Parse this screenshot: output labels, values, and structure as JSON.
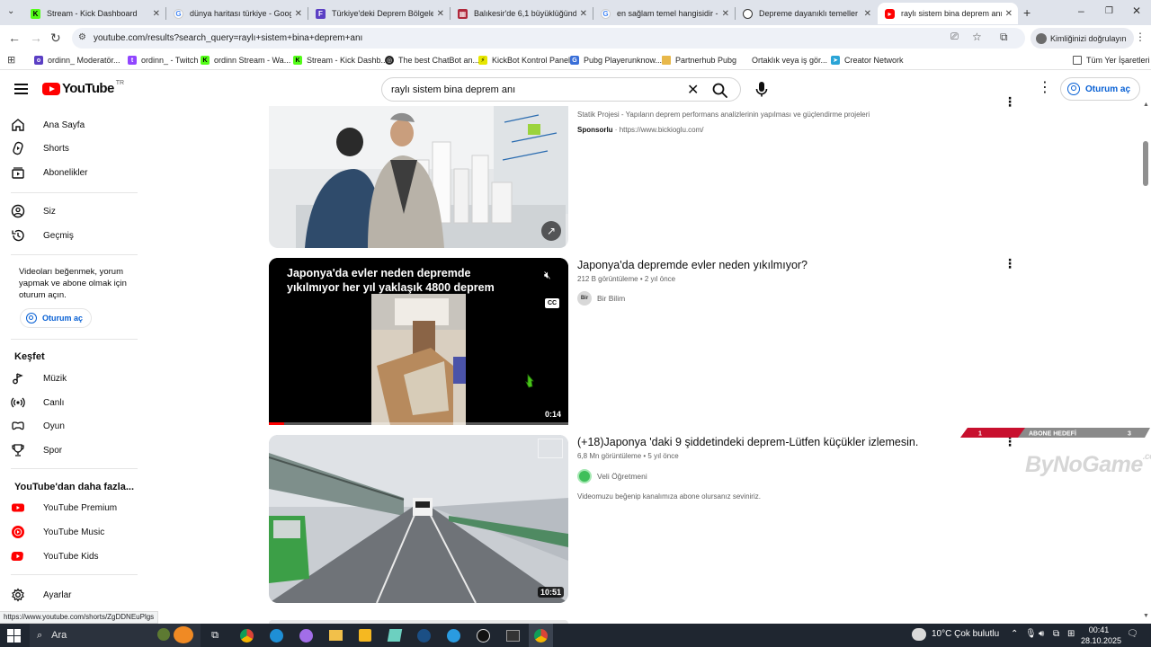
{
  "browser": {
    "tabs": [
      {
        "title": "Stream - Kick Dashboard",
        "icon": "kick-icon",
        "color": "#53fc18"
      },
      {
        "title": "dünya haritası türkiye - Google",
        "icon": "google-icon",
        "color": "#4285f4"
      },
      {
        "title": "Türkiye'deki Deprem Bölgeleri",
        "icon": "document-icon",
        "color": "#5b3fc4"
      },
      {
        "title": "Balıkesir'de 6,1 büyüklüğünde",
        "icon": "news-icon",
        "color": "#b0283b"
      },
      {
        "title": "en sağlam temel hangisidir - G",
        "icon": "google-icon",
        "color": "#4285f4"
      },
      {
        "title": "Depreme dayanıklı temeller",
        "icon": "openai-icon",
        "color": "#333333"
      },
      {
        "title": "raylı sistem bina deprem anı - Y",
        "icon": "youtube-icon",
        "color": "#ff0000"
      }
    ],
    "url": "youtube.com/results?search_query=raylı+sistem+bina+deprem+anı",
    "verify_label": "Kimliğinizi doğrulayın",
    "bookmarks": [
      {
        "label": "ordinn_ Moderatör...",
        "icon": "kick-icon",
        "color": "#5b3fc4"
      },
      {
        "label": "ordinn_ - Twitch",
        "icon": "twitch-icon",
        "color": "#9146ff"
      },
      {
        "label": "ordinn Stream - Wa...",
        "icon": "kick-icon",
        "color": "#53fc18"
      },
      {
        "label": "Stream - Kick Dashb...",
        "icon": "kick-icon",
        "color": "#53fc18"
      },
      {
        "label": "The best ChatBot an...",
        "icon": "chatbot-icon",
        "color": "#222222"
      },
      {
        "label": "KickBot Kontrol Paneli",
        "icon": "kickbot-icon",
        "color": "#e6e600"
      },
      {
        "label": "Pubg Playerunknow...",
        "icon": "pubg-icon",
        "color": "#3a6fd8"
      },
      {
        "label": "Partnerhub Pubg",
        "icon": "folder-icon",
        "color": "#e8b84a"
      },
      {
        "label": "Ortaklık veya iş gör...",
        "icon": "link-icon",
        "color": "#ffffff"
      },
      {
        "label": "Creator Network",
        "icon": "creator-network-icon",
        "color": "#2aa4d6"
      }
    ],
    "all_bookmarks_label": "Tüm Yer İşaretleri",
    "status_url": "https://www.youtube.com/shorts/ZgDDNEuPlgs"
  },
  "youtube": {
    "logo_text": "YouTube",
    "logo_region": "TR",
    "search_value": "raylı sistem bina deprem anı",
    "signin_label": "Oturum aç",
    "sidebar": {
      "main": [
        {
          "label": "Ana Sayfa",
          "icon": "home-icon"
        },
        {
          "label": "Shorts",
          "icon": "shorts-icon"
        },
        {
          "label": "Abonelikler",
          "icon": "subscriptions-icon"
        }
      ],
      "you": [
        {
          "label": "Siz",
          "icon": "you-icon"
        },
        {
          "label": "Geçmiş",
          "icon": "history-icon"
        }
      ],
      "note": "Videoları beğenmek, yorum yapmak ve abone olmak için oturum açın.",
      "signin_label": "Oturum aç",
      "explore_title": "Keşfet",
      "explore": [
        {
          "label": "Müzik",
          "icon": "music-icon"
        },
        {
          "label": "Canlı",
          "icon": "live-icon"
        },
        {
          "label": "Oyun",
          "icon": "gaming-icon"
        },
        {
          "label": "Spor",
          "icon": "trophy-icon"
        }
      ],
      "more_title": "YouTube'dan daha fazla...",
      "more": [
        {
          "label": "YouTube Premium",
          "icon": "youtube-premium-icon"
        },
        {
          "label": "YouTube Music",
          "icon": "youtube-music-icon"
        },
        {
          "label": "YouTube Kids",
          "icon": "youtube-kids-icon"
        }
      ],
      "settings_label": "Ayarlar"
    },
    "results": [
      {
        "type": "ad",
        "description": "Statik Projesi - Yapıların deprem performans analizlerinin yapılması ve güçlendirme projeleri",
        "sponsor_label": "Sponsorlu",
        "sponsor_url": "https://www.bickioglu.com/"
      },
      {
        "title": "Japonya'da depremde evler neden yıkılmıyor?",
        "views": "212 B görüntüleme",
        "age": "2 yıl önce",
        "channel": "Bir Bilim",
        "channel_avatar_text": "Bir",
        "duration": "0:14",
        "thumb_caption": "Japonya'da evler neden depremde yıkılmıyor her yıl yaklaşık 4800 deprem",
        "cc_label": "CC",
        "progress": 0.05
      },
      {
        "title": "(+18)Japonya 'daki 9 şiddetindeki deprem-Lütfen küçükler izlemesin.",
        "views": "6,8 Mn görüntüleme",
        "age": "5 yıl önce",
        "channel": "Veli Öğretmeni",
        "description": "Videomuzu beğenip kanalımıza abone olursanız seviniriz.",
        "duration": "10:51"
      }
    ]
  },
  "overlay": {
    "left_value": "1",
    "label": "ABONE HEDEFİ",
    "right_value": "3",
    "logo_text": "ByNoGame",
    "logo_suffix": ".com"
  },
  "taskbar": {
    "search_label": "Ara",
    "weather": "10°C  Çok bulutlu",
    "time": "00:41",
    "date": "28.10.2025"
  }
}
